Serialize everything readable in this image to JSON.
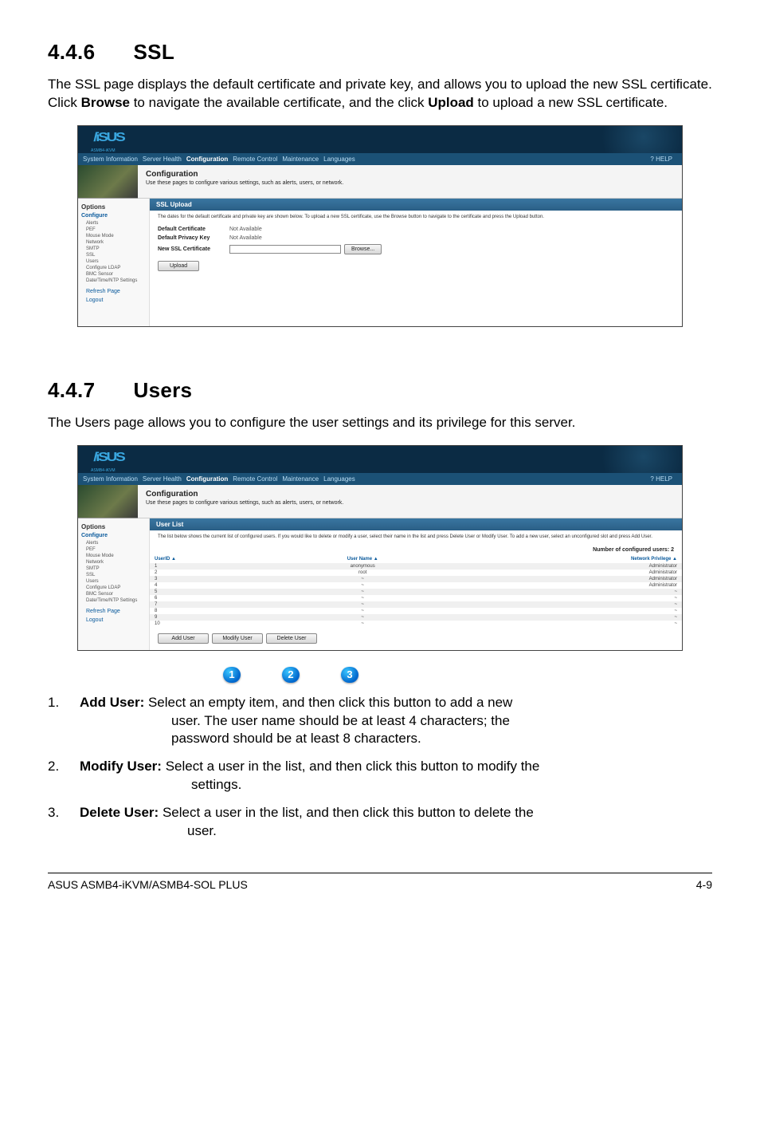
{
  "sections": {
    "ssl": {
      "num": "4.4.6",
      "title": "SSL",
      "body": "The SSL page displays the default certificate and private key, and allows you to upload the new SSL certificate. Click Browse to navigate the available certificate, and the click Upload to upload a new SSL certificate.",
      "bold1": "Browse",
      "bold2": "Upload"
    },
    "users": {
      "num": "4.4.7",
      "title": "Users",
      "body": "The Users page allows you to configure the user settings and its privilege for this server."
    }
  },
  "shot_common": {
    "logo": "/iSUS",
    "logo_sub": "ASMB4-iKVM",
    "nav": {
      "items": [
        "System Information",
        "Server Health",
        "Configuration",
        "Remote Control",
        "Maintenance",
        "Languages"
      ],
      "active_index": 2,
      "help": "? HELP"
    },
    "conf_title": "Configuration",
    "conf_sub": "Use these pages to configure various settings, such as alerts, users, or network.",
    "sidebar": {
      "options": "Options",
      "configure": "Configure",
      "items": [
        "Alerts",
        "PEF",
        "Mouse Mode",
        "Network",
        "SMTP",
        "SSL",
        "Users",
        "Configure LDAP",
        "BMC Sensor",
        "Date/Time/NTP Settings"
      ],
      "refresh": "Refresh Page",
      "logout": "Logout"
    }
  },
  "ssl_shot": {
    "bar": "SSL Upload",
    "desc": "The dates for the default certificate and private key are shown below. To upload a new SSL certificate, use the Browse button to navigate to the certificate and press the Upload button.",
    "rows": {
      "cert_label": "Default Certificate",
      "cert_val": "Not Available",
      "key_label": "Default Privacy Key",
      "key_val": "Not Available",
      "new_label": "New SSL Certificate"
    },
    "browse": "Browse...",
    "upload": "Upload"
  },
  "users_shot": {
    "bar": "User List",
    "desc": "The list below shows the current list of configured users. If you would like to delete or modify a user, select their name in the list and press Delete User or Modify User. To add a new user, select an unconfigured slot and press Add User.",
    "count": "Number of configured users: 2",
    "headers": {
      "id": "UserID",
      "name": "User Name",
      "priv": "Network Privilege"
    },
    "rows": [
      {
        "id": "1",
        "name": "anonymous",
        "priv": "Administrator"
      },
      {
        "id": "2",
        "name": "root",
        "priv": "Administrator"
      },
      {
        "id": "3",
        "name": "~",
        "priv": "Administrator"
      },
      {
        "id": "4",
        "name": "~",
        "priv": "Administrator"
      },
      {
        "id": "5",
        "name": "~",
        "priv": "~"
      },
      {
        "id": "6",
        "name": "~",
        "priv": "~"
      },
      {
        "id": "7",
        "name": "~",
        "priv": "~"
      },
      {
        "id": "8",
        "name": "~",
        "priv": "~"
      },
      {
        "id": "9",
        "name": "~",
        "priv": "~"
      },
      {
        "id": "10",
        "name": "~",
        "priv": "~"
      }
    ],
    "buttons": {
      "add": "Add User",
      "modify": "Modify User",
      "del": "Delete User"
    }
  },
  "badges": {
    "b1": "1",
    "b2": "2",
    "b3": "3"
  },
  "desc_list": {
    "i1": {
      "n": "1.",
      "b": "Add User:",
      "t": " Select an empty item, and then click this button to add a new",
      "t2": "user. The user name should be at least 4 characters; the",
      "t3": "password should be at least 8 characters."
    },
    "i2": {
      "n": "2.",
      "b": "Modify User:",
      "t": " Select a user in the list, and then click this button to modify the",
      "t2": "settings."
    },
    "i3": {
      "n": "3.",
      "b": "Delete User:",
      "t": " Select a user in the list, and then click this button to delete the",
      "t2": "user."
    }
  },
  "footer": {
    "left": "ASUS ASMB4-iKVM/ASMB4-SOL PLUS",
    "right": "4-9"
  }
}
